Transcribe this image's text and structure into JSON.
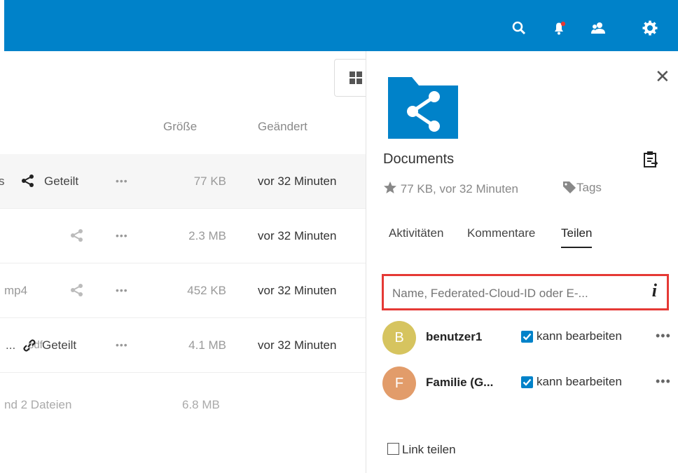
{
  "header": {
    "icons": [
      "search-icon",
      "notifications-icon",
      "contacts-icon",
      "settings-icon"
    ]
  },
  "files": {
    "columns": {
      "size": "Größe",
      "modified": "Geändert"
    },
    "rows": [
      {
        "name_fragment": "s",
        "shared_label": "Geteilt",
        "size": "77 KB",
        "modified": "vor 32 Minuten"
      },
      {
        "name_fragment": "",
        "shared_label": "",
        "size": "2.3 MB",
        "modified": "vor 32 Minuten"
      },
      {
        "name_fragment": "mp4",
        "shared_label": "",
        "size": "452 KB",
        "modified": "vor 32 Minuten"
      },
      {
        "name_fragment": "...",
        "name_ext": "pdf",
        "shared_label": "Geteilt",
        "size": "4.1 MB",
        "modified": "vor 32 Minuten"
      }
    ],
    "summary": {
      "label": "nd 2 Dateien",
      "size": "6.8 MB"
    }
  },
  "sidebar": {
    "title": "Documents",
    "meta": "77 KB, vor 32 Minuten",
    "tags_label": "Tags",
    "tabs": [
      "Aktivitäten",
      "Kommentare",
      "Teilen"
    ],
    "active_tab": "Teilen",
    "share_input_placeholder": "Name, Federated-Cloud-ID oder E-...",
    "info_label": "i",
    "sharees": [
      {
        "initial": "B",
        "name": "benutzer1",
        "permission": "kann bearbeiten",
        "avatar_color": "#d6c45f"
      },
      {
        "initial": "F",
        "name": "Familie (G...",
        "permission": "kann bearbeiten",
        "avatar_color": "#e29c6a"
      }
    ],
    "link_share_label": "Link teilen"
  },
  "colors": {
    "header": "#0082c9",
    "highlight_border": "#e53935"
  }
}
